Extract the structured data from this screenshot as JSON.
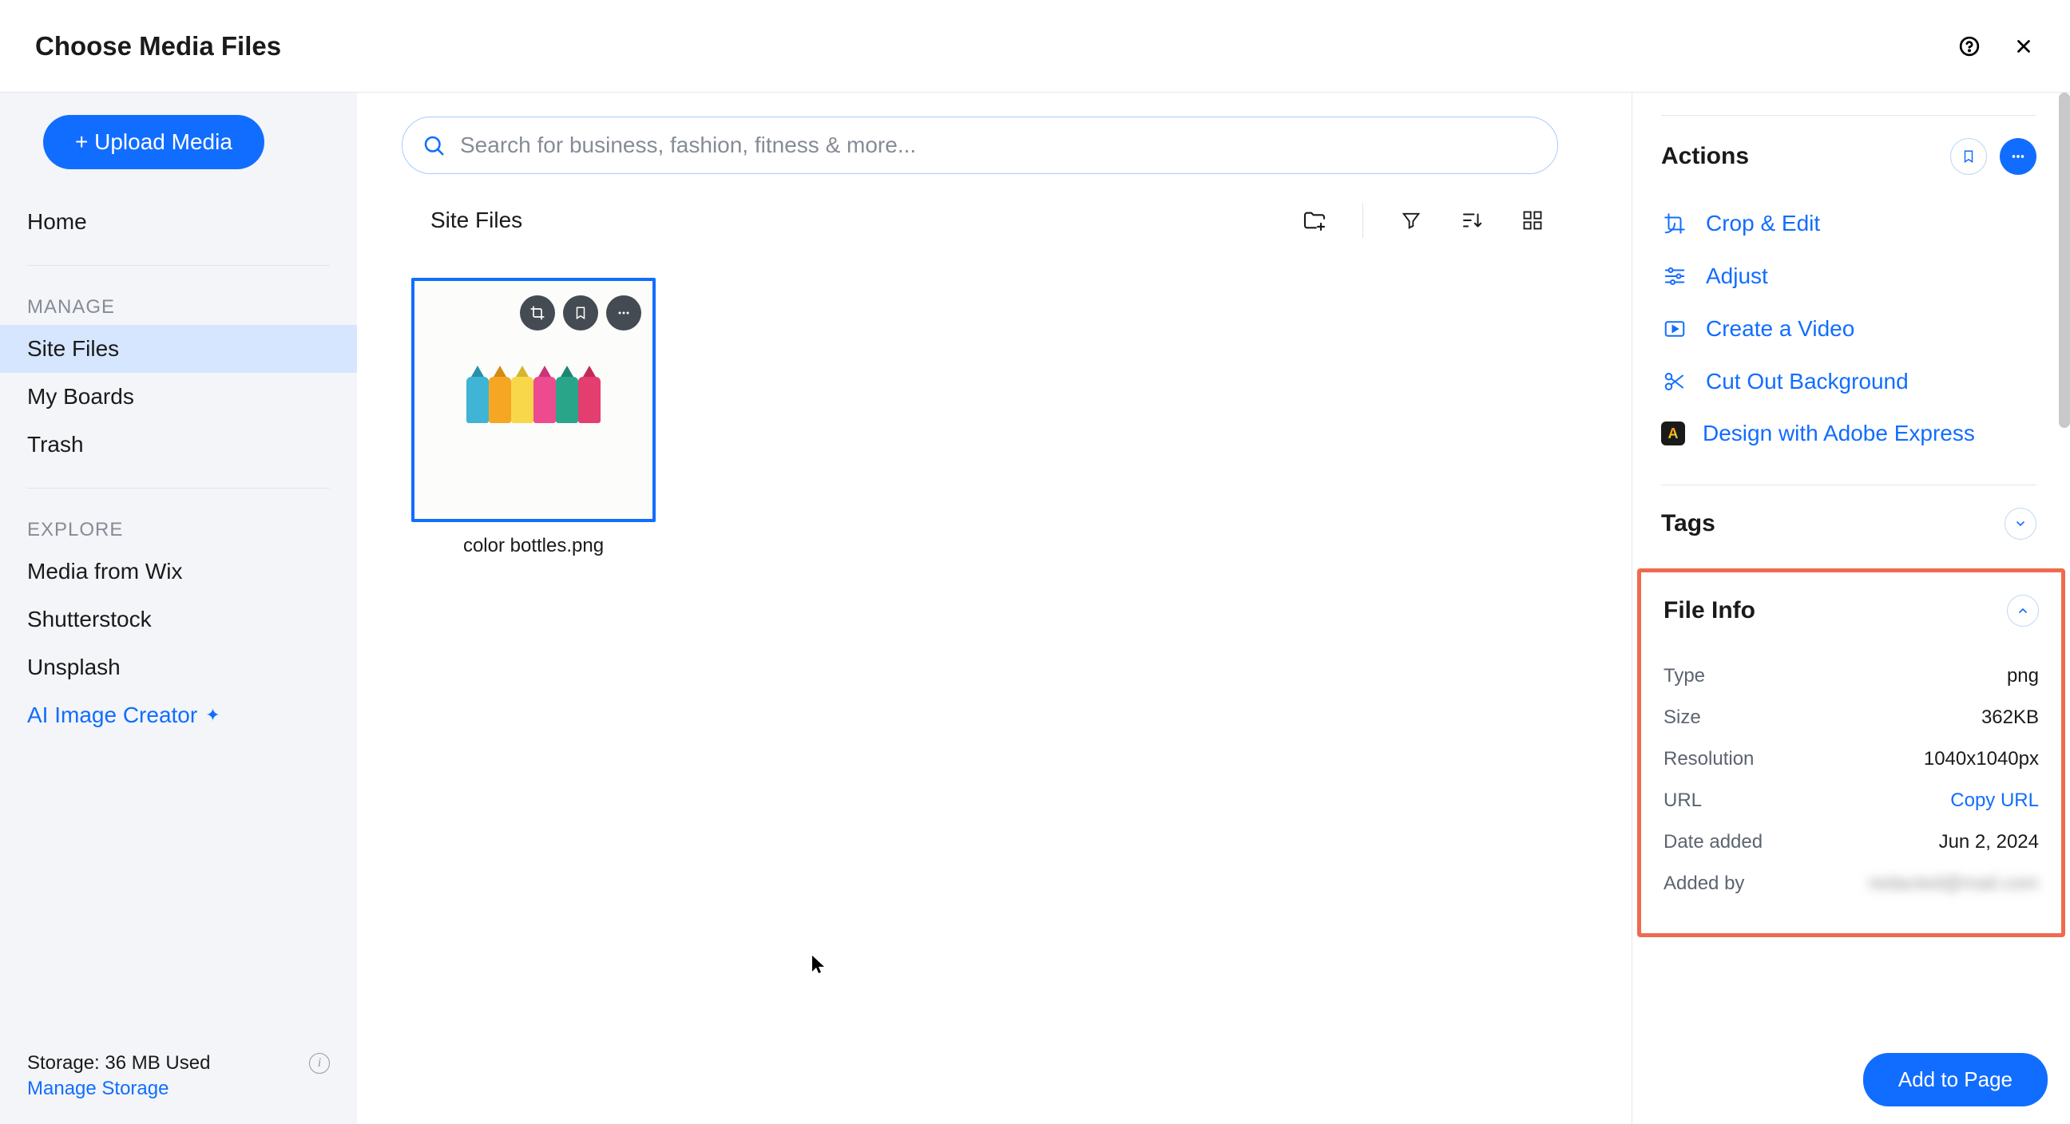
{
  "header": {
    "title": "Choose Media Files"
  },
  "sidebar": {
    "upload": "+ Upload Media",
    "home": "Home",
    "manage_label": "MANAGE",
    "items_manage": [
      "Site Files",
      "My Boards",
      "Trash"
    ],
    "explore_label": "EXPLORE",
    "items_explore": [
      "Media from Wix",
      "Shutterstock",
      "Unsplash"
    ],
    "ai_creator": "AI Image Creator",
    "storage": "Storage: 36 MB Used",
    "manage_storage": "Manage Storage"
  },
  "search": {
    "placeholder": "Search for business, fashion, fitness & more..."
  },
  "toolbar": {
    "title": "Site Files"
  },
  "media": {
    "items": [
      {
        "label": "color bottles.png"
      }
    ]
  },
  "panel": {
    "actions_title": "Actions",
    "actions": {
      "crop": "Crop & Edit",
      "adjust": "Adjust",
      "video": "Create a Video",
      "cutout": "Cut Out Background",
      "adobe": "Design with Adobe Express"
    },
    "tags_title": "Tags",
    "fileinfo_title": "File Info",
    "fileinfo": {
      "type_k": "Type",
      "type_v": "png",
      "size_k": "Size",
      "size_v": "362KB",
      "res_k": "Resolution",
      "res_v": "1040x1040px",
      "url_k": "URL",
      "url_v": "Copy URL",
      "date_k": "Date added",
      "date_v": "Jun 2, 2024",
      "added_k": "Added by",
      "added_v": "redacted@mail.com"
    },
    "add_button": "Add to Page"
  }
}
